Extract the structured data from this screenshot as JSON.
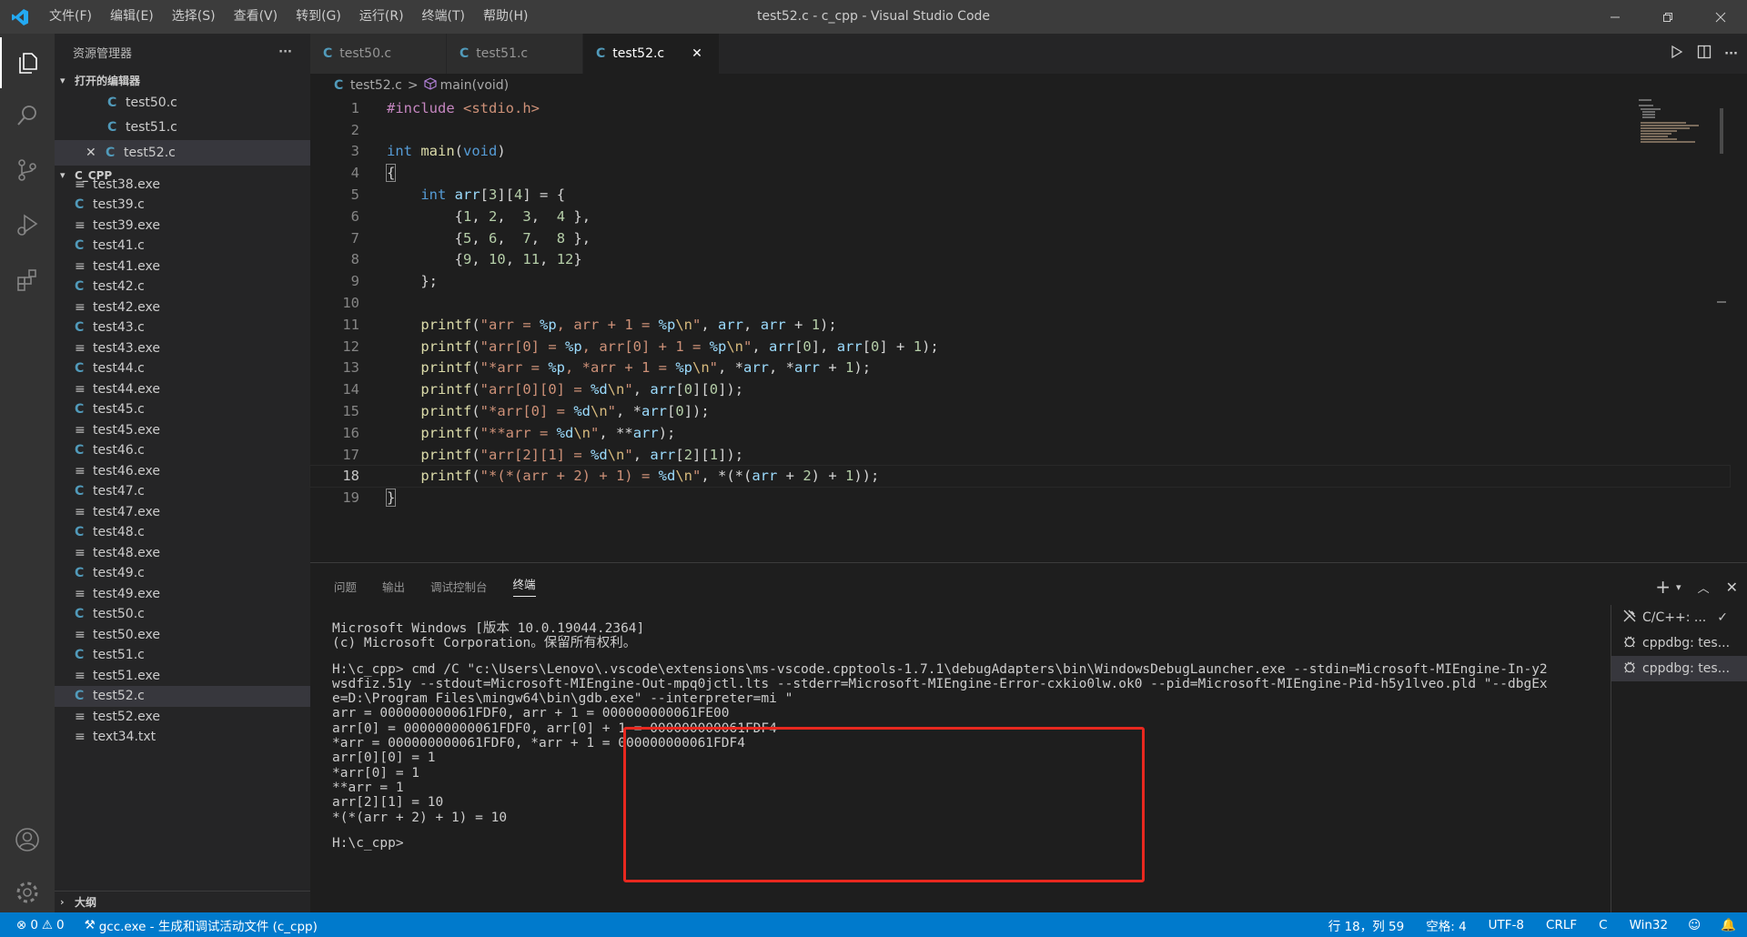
{
  "app": {
    "window_title": "test52.c - c_cpp - Visual Studio Code",
    "menu": [
      "文件(F)",
      "编辑(E)",
      "选择(S)",
      "查看(V)",
      "转到(G)",
      "运行(R)",
      "终端(T)",
      "帮助(H)"
    ]
  },
  "sidebar": {
    "title": "资源管理器",
    "more": "···",
    "open_editors_label": "打开的编辑器",
    "open_editors": [
      "test50.c",
      "test51.c",
      "test52.c"
    ],
    "folder_label": "C_CPP",
    "files": [
      {
        "name": "test38.exe",
        "type": "exe"
      },
      {
        "name": "test39.c",
        "type": "c"
      },
      {
        "name": "test39.exe",
        "type": "exe"
      },
      {
        "name": "test41.c",
        "type": "c"
      },
      {
        "name": "test41.exe",
        "type": "exe"
      },
      {
        "name": "test42.c",
        "type": "c"
      },
      {
        "name": "test42.exe",
        "type": "exe"
      },
      {
        "name": "test43.c",
        "type": "c"
      },
      {
        "name": "test43.exe",
        "type": "exe"
      },
      {
        "name": "test44.c",
        "type": "c"
      },
      {
        "name": "test44.exe",
        "type": "exe"
      },
      {
        "name": "test45.c",
        "type": "c"
      },
      {
        "name": "test45.exe",
        "type": "exe"
      },
      {
        "name": "test46.c",
        "type": "c"
      },
      {
        "name": "test46.exe",
        "type": "exe"
      },
      {
        "name": "test47.c",
        "type": "c"
      },
      {
        "name": "test47.exe",
        "type": "exe"
      },
      {
        "name": "test48.c",
        "type": "c"
      },
      {
        "name": "test48.exe",
        "type": "exe"
      },
      {
        "name": "test49.c",
        "type": "c"
      },
      {
        "name": "test49.exe",
        "type": "exe"
      },
      {
        "name": "test50.c",
        "type": "c"
      },
      {
        "name": "test50.exe",
        "type": "exe"
      },
      {
        "name": "test51.c",
        "type": "c"
      },
      {
        "name": "test51.exe",
        "type": "exe"
      },
      {
        "name": "test52.c",
        "type": "c",
        "selected": true
      },
      {
        "name": "test52.exe",
        "type": "exe"
      },
      {
        "name": "text34.txt",
        "type": "txt"
      }
    ],
    "outline_label": "大纲"
  },
  "tabs": [
    {
      "label": "test50.c",
      "active": false
    },
    {
      "label": "test51.c",
      "active": false
    },
    {
      "label": "test52.c",
      "active": true,
      "close": "✕"
    }
  ],
  "breadcrumb": {
    "file": "test52.c",
    "sep": ">",
    "symbol": "main(void)"
  },
  "code": {
    "current_line": 18,
    "line_numbers": [
      "1",
      "2",
      "3",
      "4",
      "5",
      "6",
      "7",
      "8",
      "9",
      "10",
      "11",
      "12",
      "13",
      "14",
      "15",
      "16",
      "17",
      "18",
      "19"
    ]
  },
  "panel": {
    "tabs": [
      "问题",
      "输出",
      "调试控制台",
      "终端"
    ],
    "active_tab": "终端",
    "terminal_lines": [
      "Microsoft Windows [版本 10.0.19044.2364]",
      "(c) Microsoft Corporation。保留所有权利。",
      "",
      "H:\\c_cpp> cmd /C \"c:\\Users\\Lenovo\\.vscode\\extensions\\ms-vscode.cpptools-1.7.1\\debugAdapters\\bin\\WindowsDebugLauncher.exe --stdin=Microsoft-MIEngine-In-y2",
      "wsdfiz.51y --stdout=Microsoft-MIEngine-Out-mpq0jctl.lts --stderr=Microsoft-MIEngine-Error-cxkio0lw.ok0 --pid=Microsoft-MIEngine-Pid-h5y1lveo.pld \"--dbgEx",
      "e=D:\\Program Files\\mingw64\\bin\\gdb.exe\" --interpreter=mi \"",
      "arr = 000000000061FDF0, arr + 1 = 000000000061FE00",
      "arr[0] = 000000000061FDF0, arr[0] + 1 = 000000000061FDF4",
      "*arr = 000000000061FDF0, *arr + 1 = 000000000061FDF4",
      "arr[0][0] = 1",
      "*arr[0] = 1",
      "**arr = 1",
      "arr[2][1] = 10",
      "*(*(arr + 2) + 1) = 10",
      "",
      "H:\\c_cpp>"
    ],
    "terminals": [
      {
        "label": "C/C++: ...",
        "check": "✓"
      },
      {
        "label": "cppdbg: tes..."
      },
      {
        "label": "cppdbg: tes...",
        "selected": true
      }
    ]
  },
  "status": {
    "errors": "0",
    "warnings": "0",
    "task": "gcc.exe - 生成和调试活动文件 (c_cpp)",
    "position": "行 18，列 59",
    "spaces": "空格: 4",
    "encoding": "UTF-8",
    "eol": "CRLF",
    "language": "C",
    "platform": "Win32"
  },
  "colors": {
    "accent": "#007acc",
    "highlight_box": "#e8281f",
    "keyword": "#569cd6",
    "string": "#ce9178",
    "function": "#dcdcaa",
    "variable": "#9cdcfe",
    "number": "#b5cea8"
  }
}
